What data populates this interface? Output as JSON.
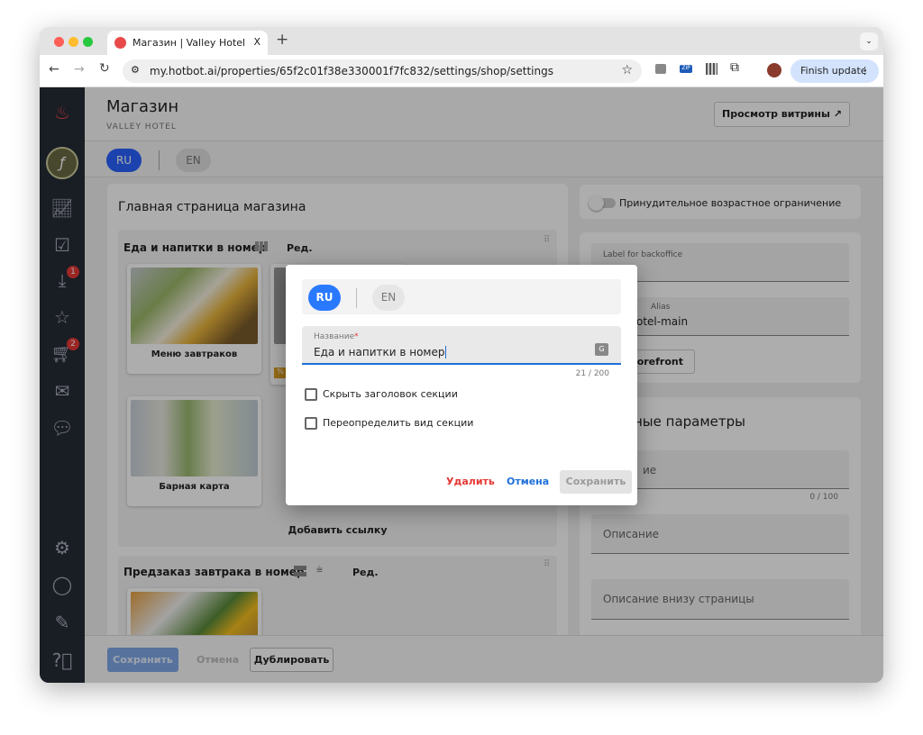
{
  "browser": {
    "tab_title": "Магазин | Valley Hotel | Hotbot",
    "url": "my.hotbot.ai/properties/65f2c01f38e330001f7fc832/settings/shop/settings",
    "finish_update": "Finish update",
    "new_tab": "+",
    "close_tab": "X"
  },
  "sidebar": {
    "badges": {
      "inbox": "1",
      "cart": "2"
    }
  },
  "header": {
    "title": "Магазин",
    "subtitle": "VALLEY HOTEL",
    "storefront_button": "Просмотр витрины ↗"
  },
  "langs": {
    "ru": "RU",
    "en": "EN"
  },
  "main": {
    "title": "Главная страница магазина",
    "sections": [
      {
        "title": "Еда и напитки в номер",
        "edit": "Ред.",
        "items": [
          "Меню завтраков",
          "Барная карта"
        ],
        "add_link": "Добавить ссылку",
        "badge": "%"
      },
      {
        "title": "Предзаказ завтрака в номер",
        "edit": "Ред."
      }
    ]
  },
  "footer": {
    "save": "Сохранить",
    "cancel": "Отмена",
    "duplicate": "Дублировать"
  },
  "right": {
    "age_toggle": "Принудительное возрастное ограничение",
    "age_toggle_on": false,
    "label_backoffice": "Label for backoffice",
    "alias_label": "Alias",
    "alias_value": "otel-main",
    "storefront_btn": "storefront",
    "params_title": "ные параметры",
    "name_field": "ие",
    "name_counter": "0 / 100",
    "description": "Описание",
    "bottom_description": "Описание внизу страницы"
  },
  "modal": {
    "lang_ru": "RU",
    "lang_en": "EN",
    "name_label": "Название",
    "required": "*",
    "name_value": "Еда и напитки в номер",
    "counter": "21 / 200",
    "hide_header": "Скрыть заголовок секции",
    "hide_header_checked": false,
    "override_view": "Переопределить вид секции",
    "override_view_checked": false,
    "delete": "Удалить",
    "cancel": "Отмена",
    "save": "Сохранить"
  },
  "colors": {
    "accent": "#2979ff",
    "danger": "#e53935",
    "sidebar": "#262b36"
  }
}
